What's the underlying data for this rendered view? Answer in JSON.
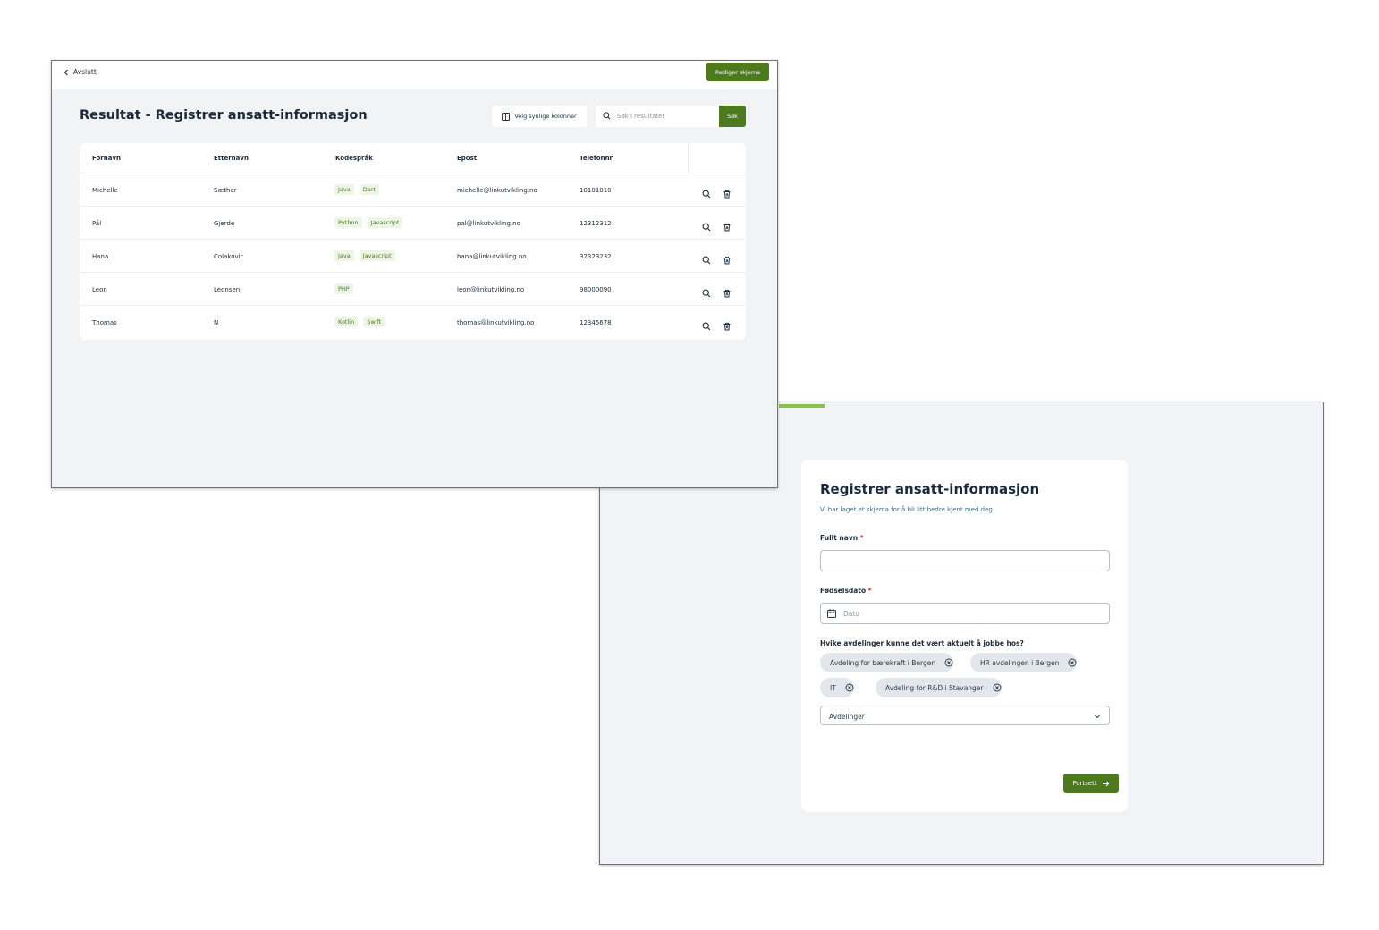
{
  "results_window": {
    "back_label": "Avslutt",
    "edit_button": "Rediger skjema",
    "title": "Resultat - Registrer ansatt-informasjon",
    "columns_button": "Velg synlige kolonner",
    "search_placeholder": "Søk i resultater",
    "search_button": "Søk",
    "table": {
      "headers": [
        "Fornavn",
        "Etternavn",
        "Kodespråk",
        "Epost",
        "Telefonnr"
      ],
      "rows": [
        {
          "first": "Michelle",
          "last": "Sæther",
          "langs": [
            "Java",
            "Dart"
          ],
          "email": "michelle@linkutvikling.no",
          "phone": "10101010"
        },
        {
          "first": "Pål",
          "last": "Gjerde",
          "langs": [
            "Python",
            "Javascript"
          ],
          "email": "pal@linkutvikling.no",
          "phone": "12312312"
        },
        {
          "first": "Hana",
          "last": "Colakovic",
          "langs": [
            "Java",
            "Javascript"
          ],
          "email": "hana@linkutvikling.no",
          "phone": "32323232"
        },
        {
          "first": "Leon",
          "last": "Leonsen",
          "langs": [
            "PHP"
          ],
          "email": "leon@linkutvikling.no",
          "phone": "98000090"
        },
        {
          "first": "Thomas",
          "last": "N",
          "langs": [
            "Kotlin",
            "Swift"
          ],
          "email": "thomas@linkutvikling.no",
          "phone": "12345678"
        }
      ]
    }
  },
  "form_window": {
    "title": "Registrer ansatt-informasjon",
    "subtitle": "Vi har laget et skjema for å bli litt bedre kjent med deg.",
    "name_label": "Fullt navn",
    "required_mark": "*",
    "name_value": "",
    "birth_label": "Fødselsdato",
    "birth_placeholder": "Dato",
    "departments_label": "Hvike avdelinger kunne det vært aktuelt å jobbe hos?",
    "selected_departments": [
      "Avdeling for bærekraft i Bergen",
      "HR avdelingen i Bergen",
      "IT",
      "Avdeling for R&D i Stavanger"
    ],
    "departments_select": "Avdelinger",
    "continue_button": "Fortsett"
  },
  "colors": {
    "accent_green": "#4d7a1f",
    "progress_green": "#8bbf4f",
    "tag_bg": "#eef5e6",
    "chip_bg": "#e3e7ec",
    "required_red": "#d8262f"
  },
  "icons": [
    "chevron-left-icon",
    "columns-icon",
    "search-icon",
    "trash-icon",
    "calendar-icon",
    "close-circle-icon",
    "chevron-down-icon",
    "arrow-right-icon"
  ]
}
